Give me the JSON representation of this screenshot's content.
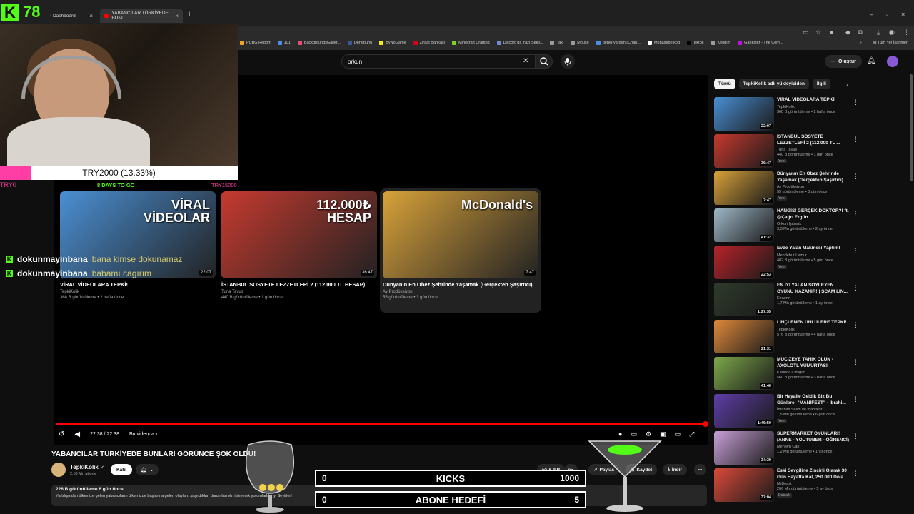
{
  "browser": {
    "tabs": [
      {
        "label": "‹ Dashboard"
      },
      {
        "label": "YABANCILAR TÜRKİYEDE BUNL"
      }
    ],
    "new_tab": "+",
    "bookmarks": [
      {
        "label": "PUBG Report",
        "color": "#f5a623"
      },
      {
        "label": "101",
        "color": "#4a90e2"
      },
      {
        "label": "BackgroundsGaller...",
        "color": "#e94e77"
      },
      {
        "label": "Denebunu",
        "color": "#3b5998"
      },
      {
        "label": "ByNoGame",
        "color": "#f8e71c"
      },
      {
        "label": "Ziraat Bankası",
        "color": "#d0021b"
      },
      {
        "label": "Minecraft Crafting",
        "color": "#7ed321"
      },
      {
        "label": "Discord'da Yazı Şekil...",
        "color": "#7289da"
      },
      {
        "label": "Takl",
        "color": "#9b9b9b"
      },
      {
        "label": "Mouse",
        "color": "#9b9b9b"
      },
      {
        "label": "genel-yardım (Chan...",
        "color": "#4a90e2"
      },
      {
        "label": "Muhasebe kod",
        "color": "#ffffff"
      },
      {
        "label": "Tiktok",
        "color": "#000000"
      },
      {
        "label": "Kendim",
        "color": "#9b9b9b"
      },
      {
        "label": "Gankster - The Com...",
        "color": "#bd10e0"
      }
    ],
    "bookmarks_more": "»",
    "bookmarks_all": "Tüm Yer İşaretleri"
  },
  "header": {
    "search_value": "orkun",
    "create_label": "Oluştur"
  },
  "player": {
    "time": "22:38 / 22:38",
    "chapter": "Bu videoda",
    "end_cards": [
      {
        "title": "VİRAL VİDEOLARA TEPKİ!",
        "channel": "TepkiKolik",
        "meta": "368 B görüntüleme • 2 hafta önce",
        "duration": "22:07",
        "thumb": "#4a8fd4",
        "thumb_text": "VİRAL VİDEOLAR"
      },
      {
        "title": "İSTANBUL SOSYETE LEZZETLERİ 2 (112.000 TL HESAP)",
        "channel": "Tuna Tavus",
        "meta": "440 B görüntüleme • 1 gün önce",
        "duration": "36:47",
        "thumb": "#c63a2f",
        "thumb_text": "112.000₺ HESAP"
      },
      {
        "title": "Dünyanın En Obez Şehrinde Yaşamak (Gerçekten Şaşırtıcı)",
        "channel": "Ay Prodüksiyon",
        "meta": "55 görüntüleme • 3 gün önce",
        "duration": "7:47",
        "thumb": "#d8a23a",
        "thumb_text": "McDonald's"
      }
    ]
  },
  "video": {
    "title": "YABANCILAR TÜRKİYEDE BUNLARI GÖRÜNCE ŞOK OLDU!",
    "channel": "TepkiKolik",
    "subs": "2,59 Mn abone",
    "join_label": "Katıl",
    "likes": "6,9 B",
    "share_label": "Paylaş",
    "save_label": "Kaydet",
    "download_label": "İndir",
    "stats": "226 B görüntüleme  6 gün önce",
    "description": "Yurtdışından ülkemize gelen yabancıların ülkemizde başlarına gelen olayları, şaşırdıkları durumları vb. izleyerek yorumladık. İyi Seyirler!"
  },
  "sidebar": {
    "chips": [
      {
        "label": "Tümü"
      },
      {
        "label": "TepkiKolik adlı yükleyiciden"
      },
      {
        "label": "İlgili"
      }
    ],
    "recs": [
      {
        "title": "VİRAL VİDEOLARA TEPKİ!",
        "channel": "TepkiKolik",
        "meta": "368 B görüntüleme • 2 hafta önce",
        "duration": "22:07",
        "badge": "",
        "thumb": "#4a8fd4"
      },
      {
        "title": "İSTANBUL SOSYETE LEZZETLERİ 2 (112.000 TL ...",
        "channel": "Tuna Tavus",
        "meta": "440 B görüntüleme • 1 gün önce",
        "duration": "36:47",
        "badge": "Yeni",
        "thumb": "#c63a2f"
      },
      {
        "title": "Dünyanın En Obez Şehrinde Yaşamak (Gerçekten Şaşırtıcı)",
        "channel": "Ay Prodüksiyon",
        "meta": "55 görüntüleme • 3 gün önce",
        "duration": "7:47",
        "badge": "Yeni",
        "thumb": "#d8a23a"
      },
      {
        "title": "HANGİSİ GERÇEK DOKTOR?! ft. @Çağrı Ergün",
        "channel": "Orkun Işıtmak",
        "meta": "3,3 Mn görüntüleme • 2 ay önce",
        "duration": "41:32",
        "badge": "",
        "thumb": "#9fb8c9"
      },
      {
        "title": "Evde Yalan Makinesi Yaptım!",
        "channel": "Mendebur Lemur",
        "meta": "482 B görüntüleme • 5 gün önce",
        "duration": "22:53",
        "badge": "Yeni",
        "thumb": "#b8232a"
      },
      {
        "title": "EN İYİ YALAN SÖYLEYEN OYUNU KAZANIR! | SCAM LIN...",
        "channel": "Elraenn",
        "meta": "1,7 Mn görüntüleme • 1 ay önce",
        "duration": "1:27:35",
        "badge": "",
        "thumb": "#2f3b2c"
      },
      {
        "title": "LİNÇLENEN ÜNLÜLERE TEPKİ!",
        "channel": "TepkiKolik",
        "meta": "576 B görüntüleme • 4 hafta önce",
        "duration": "21:31",
        "badge": "",
        "thumb": "#e0893a"
      },
      {
        "title": "MUCİZEYE TANIK OLUN - AXOLOTL YUMURTASI",
        "channel": "Karınca Çiftliğim",
        "meta": "560 B görüntüleme • 3 hafta önce",
        "duration": "41:40",
        "badge": "",
        "thumb": "#7da84a"
      },
      {
        "title": "Bir Hayalle Geldik Biz Bu Günlere! \"MANİFEST\" - İbrahi...",
        "channel": "İbrahim Selim  ve manifest",
        "meta": "1,5 Mn görüntüleme • 6 gün önce",
        "duration": "1:46:50",
        "badge": "Yeni",
        "thumb": "#5e3ea8"
      },
      {
        "title": "SUPERMARKET OYUNLARI! (ANNE - YOUTUBER - ÖĞRENCİ)",
        "channel": "Meryem Can",
        "meta": "1,2 Mn görüntüleme • 1 yıl önce",
        "duration": "34:39",
        "badge": "",
        "thumb": "#c9a0d8"
      },
      {
        "title": "Eski Sevgiline Zincirli Olarak 30 Gün Hayatta Kal, 250.000 Dola...",
        "channel": "MrBeast",
        "meta": "206 Mn görüntüleme • 5 ay önce",
        "duration": "37:04",
        "badge": "Dublajlı",
        "thumb": "#d94a3a"
      }
    ]
  },
  "overlay": {
    "kick_count": "78",
    "goal_text": "TRY2000 (13.33%)",
    "goal_progress": 0.1333,
    "goal_start": "TRY0",
    "goal_days": "8 DAYS TO GO",
    "goal_target": "TRY15000",
    "chat": [
      {
        "user": "dokunmayinbana",
        "msg": "bana kimse dokunamaz"
      },
      {
        "user": "dokunmayinbana",
        "msg": "babamı cagırım"
      }
    ],
    "kicks": {
      "current": "0",
      "label": "KICKS",
      "target": "1000"
    },
    "subs_goal": {
      "current": "0",
      "label": "ABONE HEDEFİ",
      "target": "5"
    }
  },
  "colors": {
    "kick_green": "#53fc18",
    "goal_pink": "#ff3ea5",
    "yt_red": "#ff0000"
  }
}
